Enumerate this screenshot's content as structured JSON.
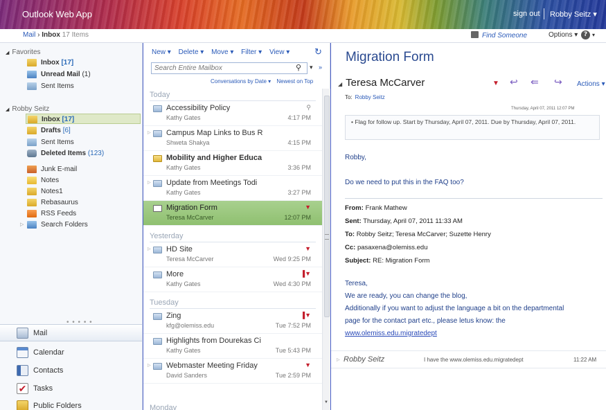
{
  "app": {
    "title": "Outlook Web App"
  },
  "topbar": {
    "sign_out": "sign out",
    "user": "Robby Seitz",
    "user_caret": "▾"
  },
  "subbar": {
    "breadcrumb": {
      "mail": "Mail",
      "sep": "›",
      "folder": "Inbox",
      "count": "17 Items"
    },
    "find_someone": "Find Someone",
    "options": "Options ▾",
    "help": "?",
    "help_caret": "▾"
  },
  "nav": {
    "favorites_label": "Favorites",
    "favorites": [
      {
        "name": "Inbox",
        "count": "[17]",
        "bold": true
      },
      {
        "name": "Unread Mail",
        "count": "(1)",
        "bold": true
      },
      {
        "name": "Sent Items",
        "count": "",
        "bold": false
      }
    ],
    "account_label": "Robby Seitz",
    "folders": [
      {
        "name": "Inbox",
        "count": "[17]"
      },
      {
        "name": "Drafts",
        "count": "[6]"
      },
      {
        "name": "Sent Items",
        "count": ""
      },
      {
        "name": "Deleted Items",
        "count": "(123)"
      },
      {
        "name": "Junk E-mail",
        "count": ""
      },
      {
        "name": "Notes",
        "count": ""
      },
      {
        "name": "Notes1",
        "count": ""
      },
      {
        "name": "Rebasaurus",
        "count": ""
      },
      {
        "name": "RSS Feeds",
        "count": ""
      },
      {
        "name": "Search Folders",
        "count": ""
      }
    ],
    "dots": "• • • • •",
    "modules": [
      "Mail",
      "Calendar",
      "Contacts",
      "Tasks",
      "Public Folders"
    ]
  },
  "list": {
    "toolbar": [
      "New ▾",
      "Delete ▾",
      "Move ▾",
      "Filter ▾",
      "View ▾"
    ],
    "refresh": "↻",
    "search_placeholder": "Search Entire Mailbox",
    "search_caret": "▾",
    "search_expand": "»",
    "sort_conv": "Conversations by Date ▾",
    "sort_order": "Newest on Top",
    "groups": [
      "Today",
      "Yesterday",
      "Tuesday",
      "Monday"
    ],
    "messages": [
      {
        "subject": "Accessibility Policy",
        "from": "Kathy Gates",
        "time": "4:17 PM",
        "flag": ""
      },
      {
        "subject": "Campus Map Links to Bus R",
        "from": "Shweta Shakya",
        "time": "4:15 PM",
        "flag": ""
      },
      {
        "subject": "Mobility and Higher Educa",
        "from": "Kathy Gates",
        "time": "3:36 PM",
        "flag": ""
      },
      {
        "subject": "Update from Meetings Todi",
        "from": "Kathy Gates",
        "time": "3:27 PM",
        "flag": ""
      },
      {
        "subject": "Migration Form",
        "from": "Teresa McCarver",
        "time": "12:07 PM",
        "flag": "▼"
      },
      {
        "subject": "HD Site",
        "from": "Teresa McCarver",
        "time": "Wed 9:25 PM",
        "flag": "▼"
      },
      {
        "subject": "More",
        "from": "Kathy Gates",
        "time": "Wed 4:30 PM",
        "flag": "▐▼"
      },
      {
        "subject": "Zing",
        "from": "kfg@olemiss.edu",
        "time": "Tue 7:52 PM",
        "flag": "▐▼"
      },
      {
        "subject": "Highlights from Dourekas Ci",
        "from": "Kathy Gates",
        "time": "Tue 5:43 PM",
        "flag": ""
      },
      {
        "subject": "Webmaster Meeting Friday",
        "from": "David Sanders",
        "time": "Tue 2:59 PM",
        "flag": "▼"
      }
    ]
  },
  "reading": {
    "subject": "Migration Form",
    "sender": "Teresa McCarver",
    "to_label": "To:",
    "to": "Robby Seitz",
    "actions": "Actions ▾",
    "date": "Thursday, April 07, 2011 12:07 PM",
    "flag_note": "• Flag for follow up. Start by Thursday, April 07, 2011. Due by Thursday, April 07, 2011.",
    "greeting": "Robby,",
    "question": "Do we need to put this in the FAQ too?",
    "from_label": "From:",
    "from_val": "Frank Mathew",
    "sent_label": "Sent:",
    "sent_val": "Thursday, April 07, 2011 11:33 AM",
    "to2_label": "To:",
    "to2_val": "Robby Seitz; Teresa McCarver; Suzette Henry",
    "cc_label": "Cc:",
    "cc_val": "pasaxena@olemiss.edu",
    "subj_label": "Subject:",
    "subj_val": "RE: Migration Form",
    "body_greeting": "Teresa,",
    "body1": "We are ready, you can change the blog,",
    "body2": "Additionally if you want to adjust the language a bit on the departmental",
    "body3": "page for the contact part etc., please letus know: the",
    "link": "www.olemiss.edu.migratedept",
    "reply_from": "Robby Seitz",
    "reply_snippet": "I have the www.olemiss.edu.migratedept",
    "reply_time": "11:22 AM"
  }
}
